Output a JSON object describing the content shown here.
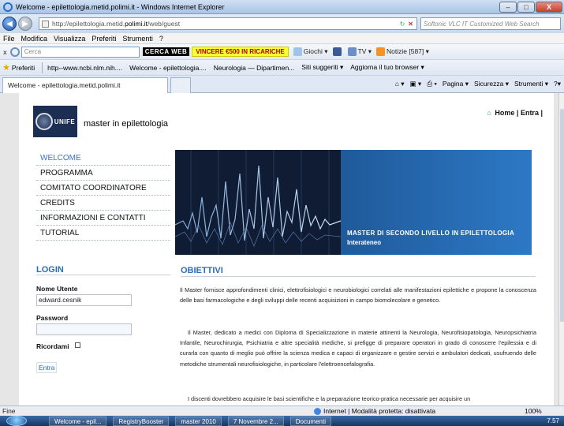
{
  "window": {
    "title": "Welcome - epilettologia.metid.polimi.it - Windows Internet Explorer",
    "minimize": "–",
    "maximize": "□",
    "close": "X"
  },
  "address": {
    "url_prefix": "http://epilettologia.metid.",
    "url_domain": "polimi.it",
    "url_suffix": "/web/guest",
    "search_placeholder": "Softonic VLC IT Customized Web Search"
  },
  "menu": [
    "File",
    "Modifica",
    "Visualizza",
    "Preferiti",
    "Strumenti",
    "?"
  ],
  "toolbar": {
    "search_placeholder": "Cerca",
    "logo": "CERCA WEB",
    "promo": "VINCERE €500 IN RICARICHE",
    "games": "Giochi",
    "tv": "TV",
    "news": "Notizie [587]"
  },
  "favorites": {
    "label": "Preferiti",
    "items": [
      "http--www.ncbi.nlm.nih....",
      "Welcome - epilettologia....",
      "Neurologia — Dipartimen...",
      "Siti suggeriti ▾",
      "Aggiorna il tuo browser ▾"
    ]
  },
  "tabs": {
    "active": "Welcome - epilettologia.metid.polimi.it",
    "tools": [
      "Pagina ▾",
      "Sicurezza ▾",
      "Strumenti ▾"
    ]
  },
  "site": {
    "logo_text": "UNIFE",
    "title": "master in epilettologia",
    "home": "Home",
    "separator": "|",
    "login_link": "Entra",
    "nav": [
      "WELCOME",
      "PROGRAMMA",
      "COMITATO COORDINATORE",
      "CREDITS",
      "INFORMAZIONI E CONTATTI",
      "TUTORIAL"
    ],
    "banner_title": "MASTER DI SECONDO LIVELLO IN EPILETTOLOGIA",
    "banner_sub": "Interateneo"
  },
  "login": {
    "heading": "LOGIN",
    "user_label": "Nome Utente",
    "user_value": "edward.cesnik",
    "pass_label": "Password",
    "remember_label": "Ricordami",
    "submit": "Entra"
  },
  "content": {
    "heading": "OBIETTIVI",
    "p1": "Il Master fornisce approfondimenti clinici, elettrofisiologici e neurobiologici correlati alle manifestazioni epilettiche e propone la conoscenza delle basi farmacologiche e degli sviluppi delle recenti acquisizioni in campo biomolecolare e genetico.",
    "p2": "Il Master, dedicato a medici con Diploma di Specializzazione in materie attinenti la Neurologia, Neurofisiopatologia, Neuropsichiatria Infantile, Neurochirurgia, Psichiatria e altre specialità mediche, si prefigge di preparare operatori in grado di conoscere l'epilessia e di curarla con quanto di meglio può offrire la scienza medica e capaci di organizzare e gestire servizi e ambulatori dedicati, usufruendo delle metodiche strumentali neurofisiologiche, in particolare l'elettroencefalografia.",
    "p3": "I discenti dovrebbero acquisire le basi scientifiche e la preparazione teorico-pratica necessarie per acquisire un"
  },
  "status": {
    "left": "Fine",
    "zone": "Internet | Modalità protetta: disattivata",
    "zoom": "100%"
  },
  "taskbar": {
    "items": [
      "Welcome - epil...",
      "RegistryBooster",
      "master 2010",
      "7 Novembre 2...",
      "Documenti"
    ],
    "clock": "7.57"
  },
  "colors": {
    "accent": "#2a6db8",
    "nav_active": "#3a73bf",
    "banner_blue": "#2d78c5"
  }
}
